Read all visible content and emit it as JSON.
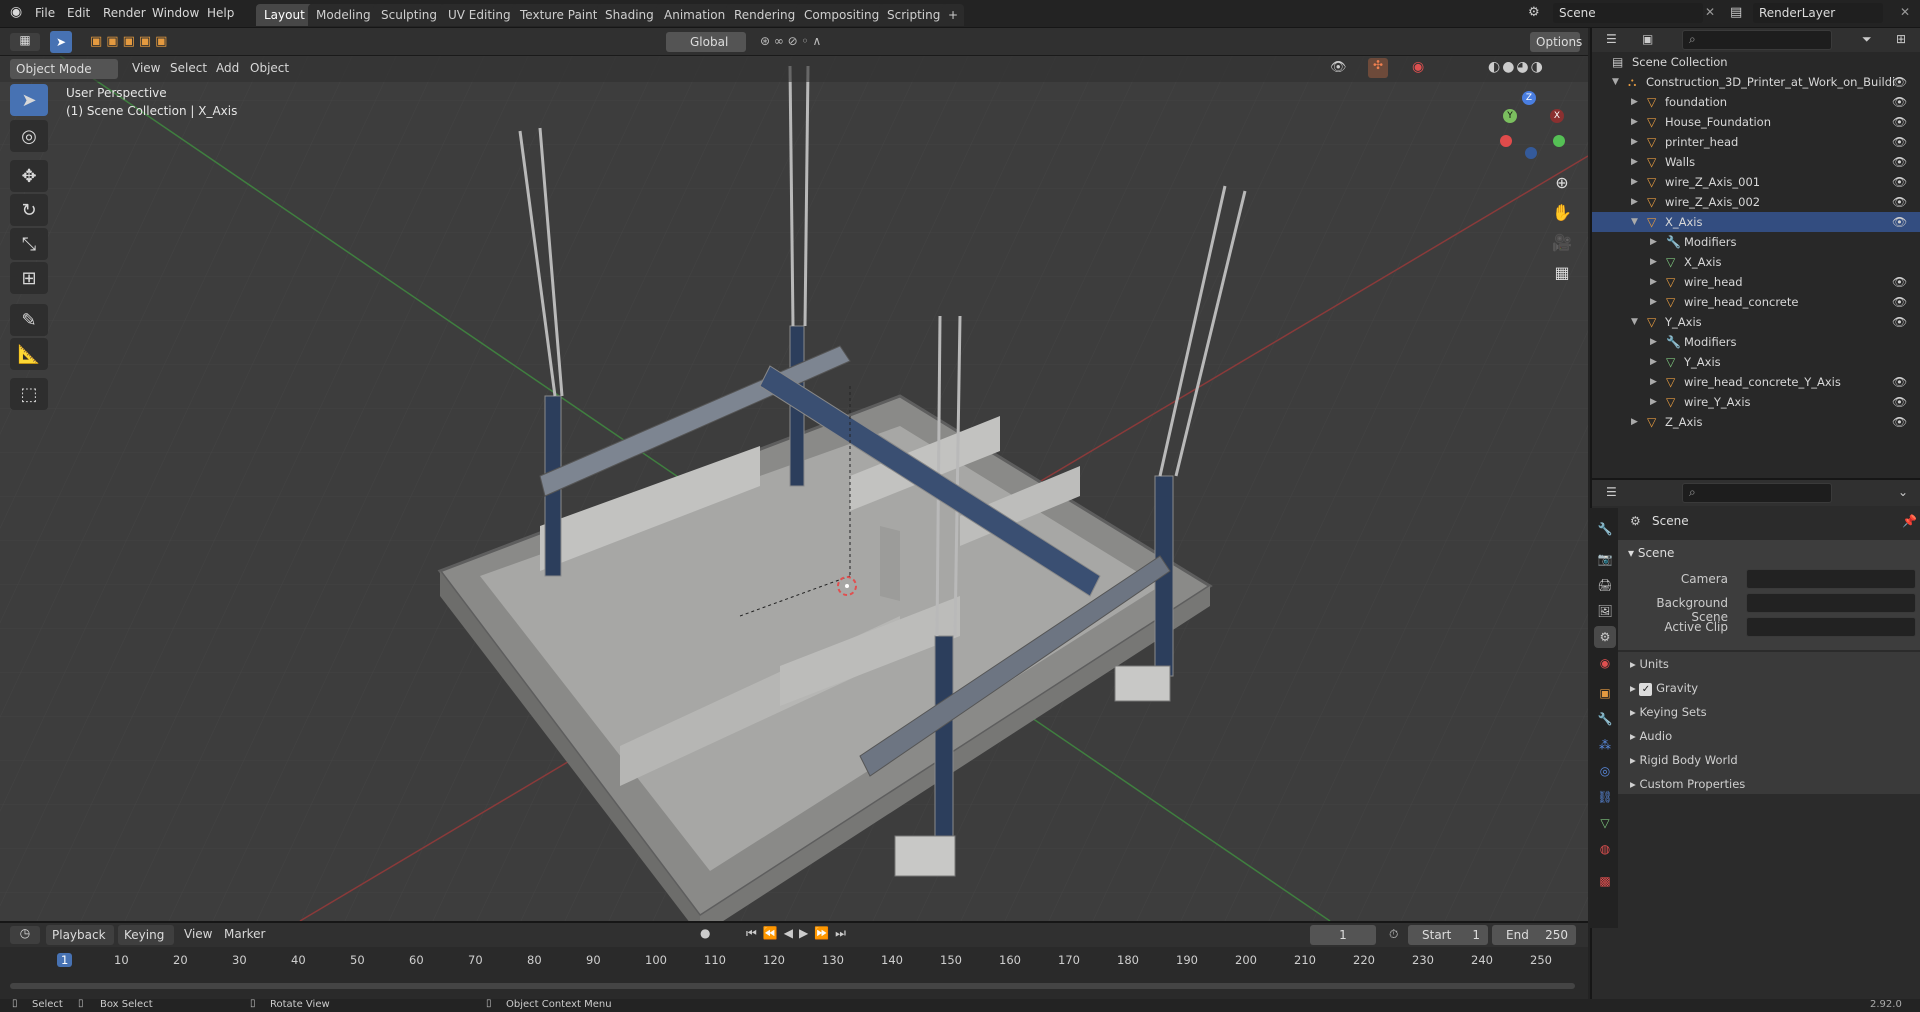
{
  "menu": [
    "File",
    "Edit",
    "Render",
    "Window",
    "Help"
  ],
  "workspace_tabs": [
    "Layout",
    "Modeling",
    "Sculpting",
    "UV Editing",
    "Texture Paint",
    "Shading",
    "Animation",
    "Rendering",
    "Compositing",
    "Scripting"
  ],
  "workspace_add": "+",
  "scene_field": "Scene",
  "renderlayer_field": "RenderLayer",
  "toolbar": {
    "transform_orientation": "Global",
    "options": "Options"
  },
  "header": {
    "mode": "Object Mode",
    "menus": [
      "View",
      "Select",
      "Add",
      "Object"
    ]
  },
  "viewport": {
    "title": "User Perspective",
    "subtitle": "(1) Scene Collection | X_Axis",
    "gizmo": {
      "z": "Z",
      "y": "Y",
      "x": "X"
    }
  },
  "outliner": {
    "root": "Scene Collection",
    "rows": [
      {
        "label": "Construction_3D_Printer_at_Work_on_Buildi",
        "depth": 1,
        "icon": "collection-icon",
        "open": true
      },
      {
        "label": "foundation",
        "depth": 2,
        "icon": "object-icon",
        "open": false
      },
      {
        "label": "House_Foundation",
        "depth": 2,
        "icon": "object-icon",
        "open": false
      },
      {
        "label": "printer_head",
        "depth": 2,
        "icon": "object-icon",
        "open": false
      },
      {
        "label": "Walls",
        "depth": 2,
        "icon": "object-icon",
        "open": false
      },
      {
        "label": "wire_Z_Axis_001",
        "depth": 2,
        "icon": "object-icon",
        "open": false
      },
      {
        "label": "wire_Z_Axis_002",
        "depth": 2,
        "icon": "object-icon",
        "open": false
      },
      {
        "label": "X_Axis",
        "depth": 2,
        "icon": "object-icon",
        "open": true,
        "selected": true
      },
      {
        "label": "Modifiers",
        "depth": 3,
        "icon": "wrench-icon",
        "open": false
      },
      {
        "label": "X_Axis",
        "depth": 3,
        "icon": "mesh-icon",
        "open": false
      },
      {
        "label": "wire_head",
        "depth": 3,
        "icon": "object-icon",
        "open": false
      },
      {
        "label": "wire_head_concrete",
        "depth": 3,
        "icon": "object-icon",
        "open": false
      },
      {
        "label": "Y_Axis",
        "depth": 2,
        "icon": "object-icon",
        "open": true
      },
      {
        "label": "Modifiers",
        "depth": 3,
        "icon": "wrench-icon",
        "open": false
      },
      {
        "label": "Y_Axis",
        "depth": 3,
        "icon": "mesh-icon",
        "open": false
      },
      {
        "label": "wire_head_concrete_Y_Axis",
        "depth": 3,
        "icon": "object-icon",
        "open": false
      },
      {
        "label": "wire_Y_Axis",
        "depth": 3,
        "icon": "object-icon",
        "open": false
      },
      {
        "label": "Z_Axis",
        "depth": 2,
        "icon": "object-icon",
        "open": false
      }
    ]
  },
  "properties": {
    "context": "Scene",
    "panel_title": "Scene",
    "camera_label": "Camera",
    "background_scene_label": "Background Scene",
    "active_clip_label": "Active Clip",
    "sections": [
      "Units",
      "Gravity",
      "Keying Sets",
      "Audio",
      "Rigid Body World",
      "Custom Properties"
    ],
    "gravity_checked": true
  },
  "timeline": {
    "menus": [
      "Playback",
      "Keying",
      "View",
      "Marker"
    ],
    "current_frame": "1",
    "start_label": "Start",
    "start": "1",
    "end_label": "End",
    "end": "250",
    "ruler": [
      "1",
      "10",
      "20",
      "30",
      "40",
      "50",
      "60",
      "70",
      "80",
      "90",
      "100",
      "110",
      "120",
      "130",
      "140",
      "150",
      "160",
      "170",
      "180",
      "190",
      "200",
      "210",
      "220",
      "230",
      "240",
      "250"
    ]
  },
  "status": {
    "select": "Select",
    "box_select": "Box Select",
    "rotate_view": "Rotate View",
    "context_menu": "Object Context Menu",
    "version": "2.92.0"
  },
  "colors": {
    "accent": "#4772b3",
    "selected_row": "#334d80",
    "object_orange": "#e49a40",
    "mesh_green": "#7dc47d"
  }
}
